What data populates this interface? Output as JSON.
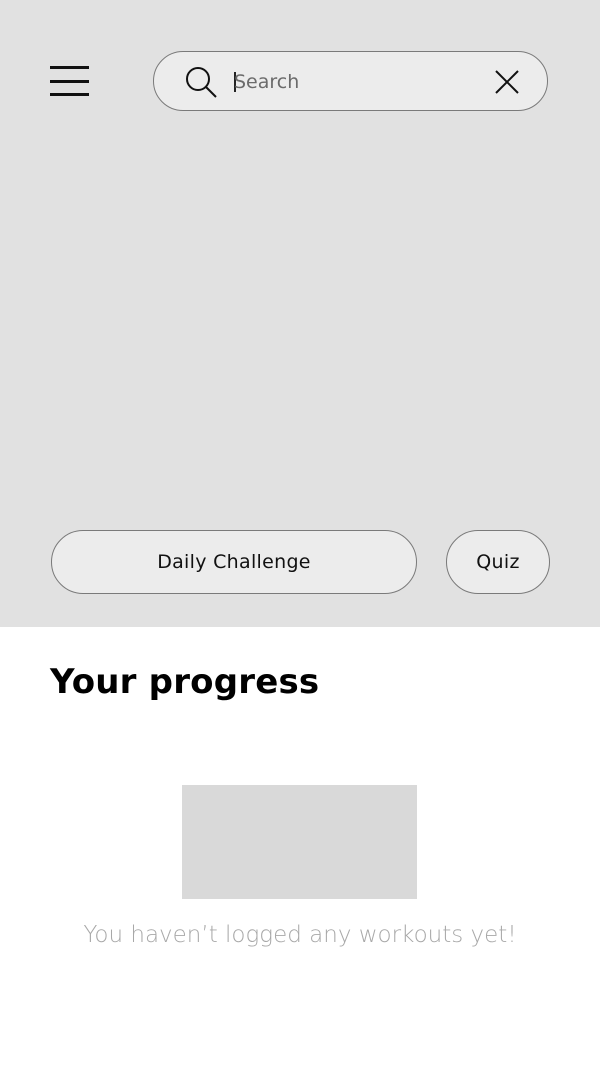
{
  "header": {
    "menu_icon": "hamburger-menu-icon",
    "search": {
      "placeholder": "Search",
      "value": "",
      "search_icon": "magnifier-icon",
      "clear_icon": "close-icon"
    }
  },
  "actions": {
    "daily_challenge_label": "Daily Challenge",
    "quiz_label": "Quiz"
  },
  "progress": {
    "title": "Your progress",
    "empty_message": "You haven’t logged any workouts yet!"
  },
  "colors": {
    "hero_background": "#e1e1e1",
    "pill_background": "#ececec",
    "placeholder_box": "#d9d9d9",
    "muted_text": "#a8a8a8"
  }
}
